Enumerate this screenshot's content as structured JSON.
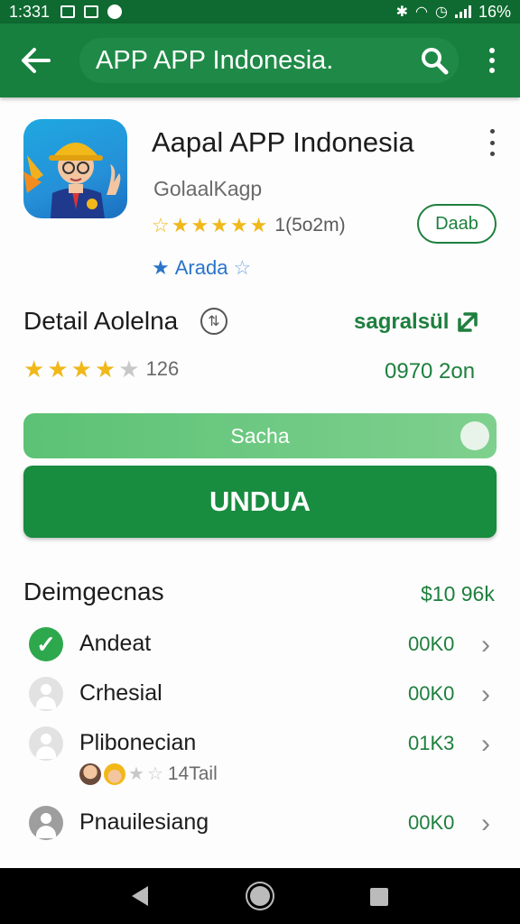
{
  "status_bar": {
    "time": "1:331",
    "battery": "16%",
    "colors": {
      "background": "#0e6a30"
    }
  },
  "toolbar": {
    "search_text": "APP APP Indonesia.",
    "colors": {
      "background": "#17803e"
    }
  },
  "app": {
    "title": "Aapal APP Indonesia",
    "developer": "GolaalKagp",
    "rating_count": "1(5o2m)",
    "badge": "Arada",
    "open_label": "Daab"
  },
  "detail": {
    "title": "Detail Aolelna",
    "link": "sagralsül",
    "rating": {
      "filled": 4,
      "total": 5,
      "count": "126"
    },
    "size": "0970 2on"
  },
  "progress": {
    "label": "Sacha",
    "fraction": 0.93
  },
  "install": {
    "label": "UNDUA",
    "colors": {
      "background": "#188c3f"
    }
  },
  "dependencies": {
    "title": "Deimgecnas",
    "total": "$10 96k",
    "items": [
      {
        "name": "Andeat",
        "size": "00K0",
        "avatar": "check-icon"
      },
      {
        "name": "Crhesial",
        "size": "00K0",
        "avatar": "user-icon"
      },
      {
        "name": "Plibonecian",
        "size": "01K3",
        "avatar": "user-icon",
        "sub_rating": {
          "filled": 2,
          "total": 4,
          "count": "14Tail"
        }
      },
      {
        "name": "Pnauilesiang",
        "size": "00K0",
        "avatar": "user-icon"
      }
    ]
  },
  "accent": "#1e7f3e"
}
